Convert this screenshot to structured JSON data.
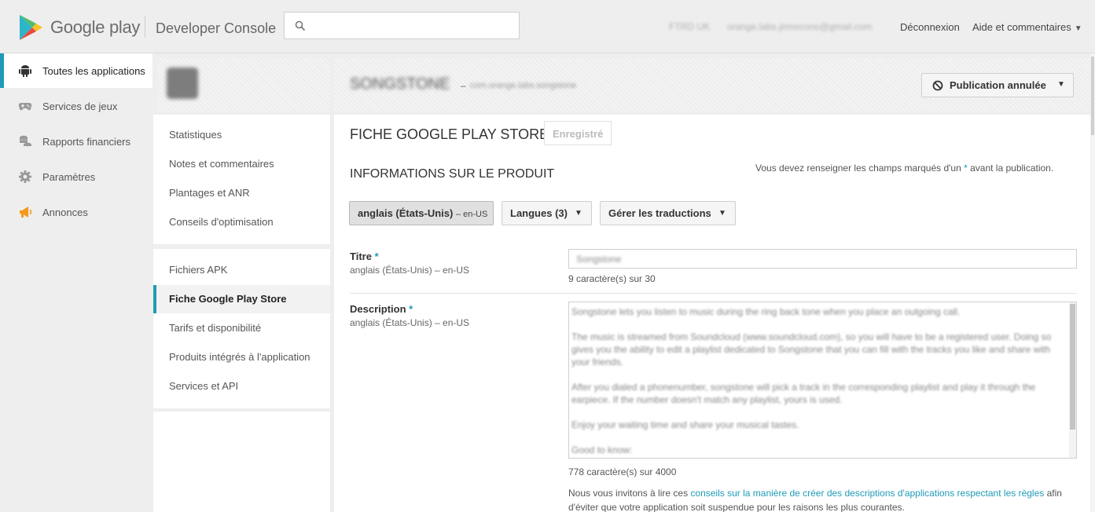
{
  "header": {
    "logo_text": "Google play",
    "console_title": "Developer Console",
    "search_placeholder": "",
    "account_name": "FTRD UK",
    "account_email": "orange.labs.jirmecons@gmail.com",
    "logout_label": "Déconnexion",
    "help_label": "Aide et commentaires"
  },
  "leftnav": {
    "items": [
      {
        "label": "Toutes les applications",
        "icon": "android-icon",
        "active": true
      },
      {
        "label": "Services de jeux",
        "icon": "gamepad-icon"
      },
      {
        "label": "Rapports financiers",
        "icon": "coins-icon"
      },
      {
        "label": "Paramètres",
        "icon": "gear-icon"
      },
      {
        "label": "Annonces",
        "icon": "megaphone-icon"
      }
    ]
  },
  "app": {
    "name": "SONGSTONE",
    "package": "com.orange.labs.songstone",
    "publication_status": "Publication annulée"
  },
  "subnav": {
    "group1": [
      "Statistiques",
      "Notes et commentaires",
      "Plantages et ANR",
      "Conseils d'optimisation"
    ],
    "group2": [
      "Fichiers APK",
      "Fiche Google Play Store",
      "Tarifs et disponibilité",
      "Produits intégrés à l'application",
      "Services et API"
    ],
    "active": "Fiche Google Play Store"
  },
  "main": {
    "page_title": "FICHE GOOGLE PLAY STORE",
    "saved_label": "Enregistré",
    "section_title": "INFORMATIONS SUR LE PRODUIT",
    "required_note_before": "Vous devez renseigner les champs marqués d'un ",
    "required_star": "*",
    "required_note_after": " avant la publication.",
    "lang_selected": "anglais (États-Unis)",
    "lang_selected_code": "– en-US",
    "languages_label": "Langues (3)",
    "translations_label": "Gérer les traductions",
    "title_field": {
      "label": "Titre",
      "star": "*",
      "sublabel": "anglais (États-Unis) – en-US",
      "value": "Songstone",
      "count": "9 caractère(s) sur 30"
    },
    "description_field": {
      "label": "Description",
      "star": "*",
      "sublabel": "anglais (États-Unis) – en-US",
      "paragraphs": [
        "Songstone lets you listen to music during the ring back tone when you place an outgoing call.",
        "The music is streamed from Soundcloud (www.soundcloud.com), so you will have to be a registered user. Doing so gives you the ability to edit a playlist dedicated to Songstone that you can fill with the tracks you like and share with your friends.",
        "After you dialed a phonenumber, songstone will pick a track in the corresponding playlist and play it through the earpiece. If the number doesn't match any playlist, yours is used.",
        "Enjoy your waiting time and share your musical tastes.",
        "Good to know:"
      ],
      "count": "778 caractère(s) sur 4000"
    },
    "advice_before": "Nous vous invitons à lire ces ",
    "advice_link": "conseils sur la manière de créer des descriptions d'applications respectant les règles",
    "advice_after": " afin d'éviter que votre application soit suspendue pour les raisons les plus courantes."
  },
  "colors": {
    "accent": "#1e9bb6",
    "background": "#eeeeee",
    "panel": "#ffffff"
  }
}
